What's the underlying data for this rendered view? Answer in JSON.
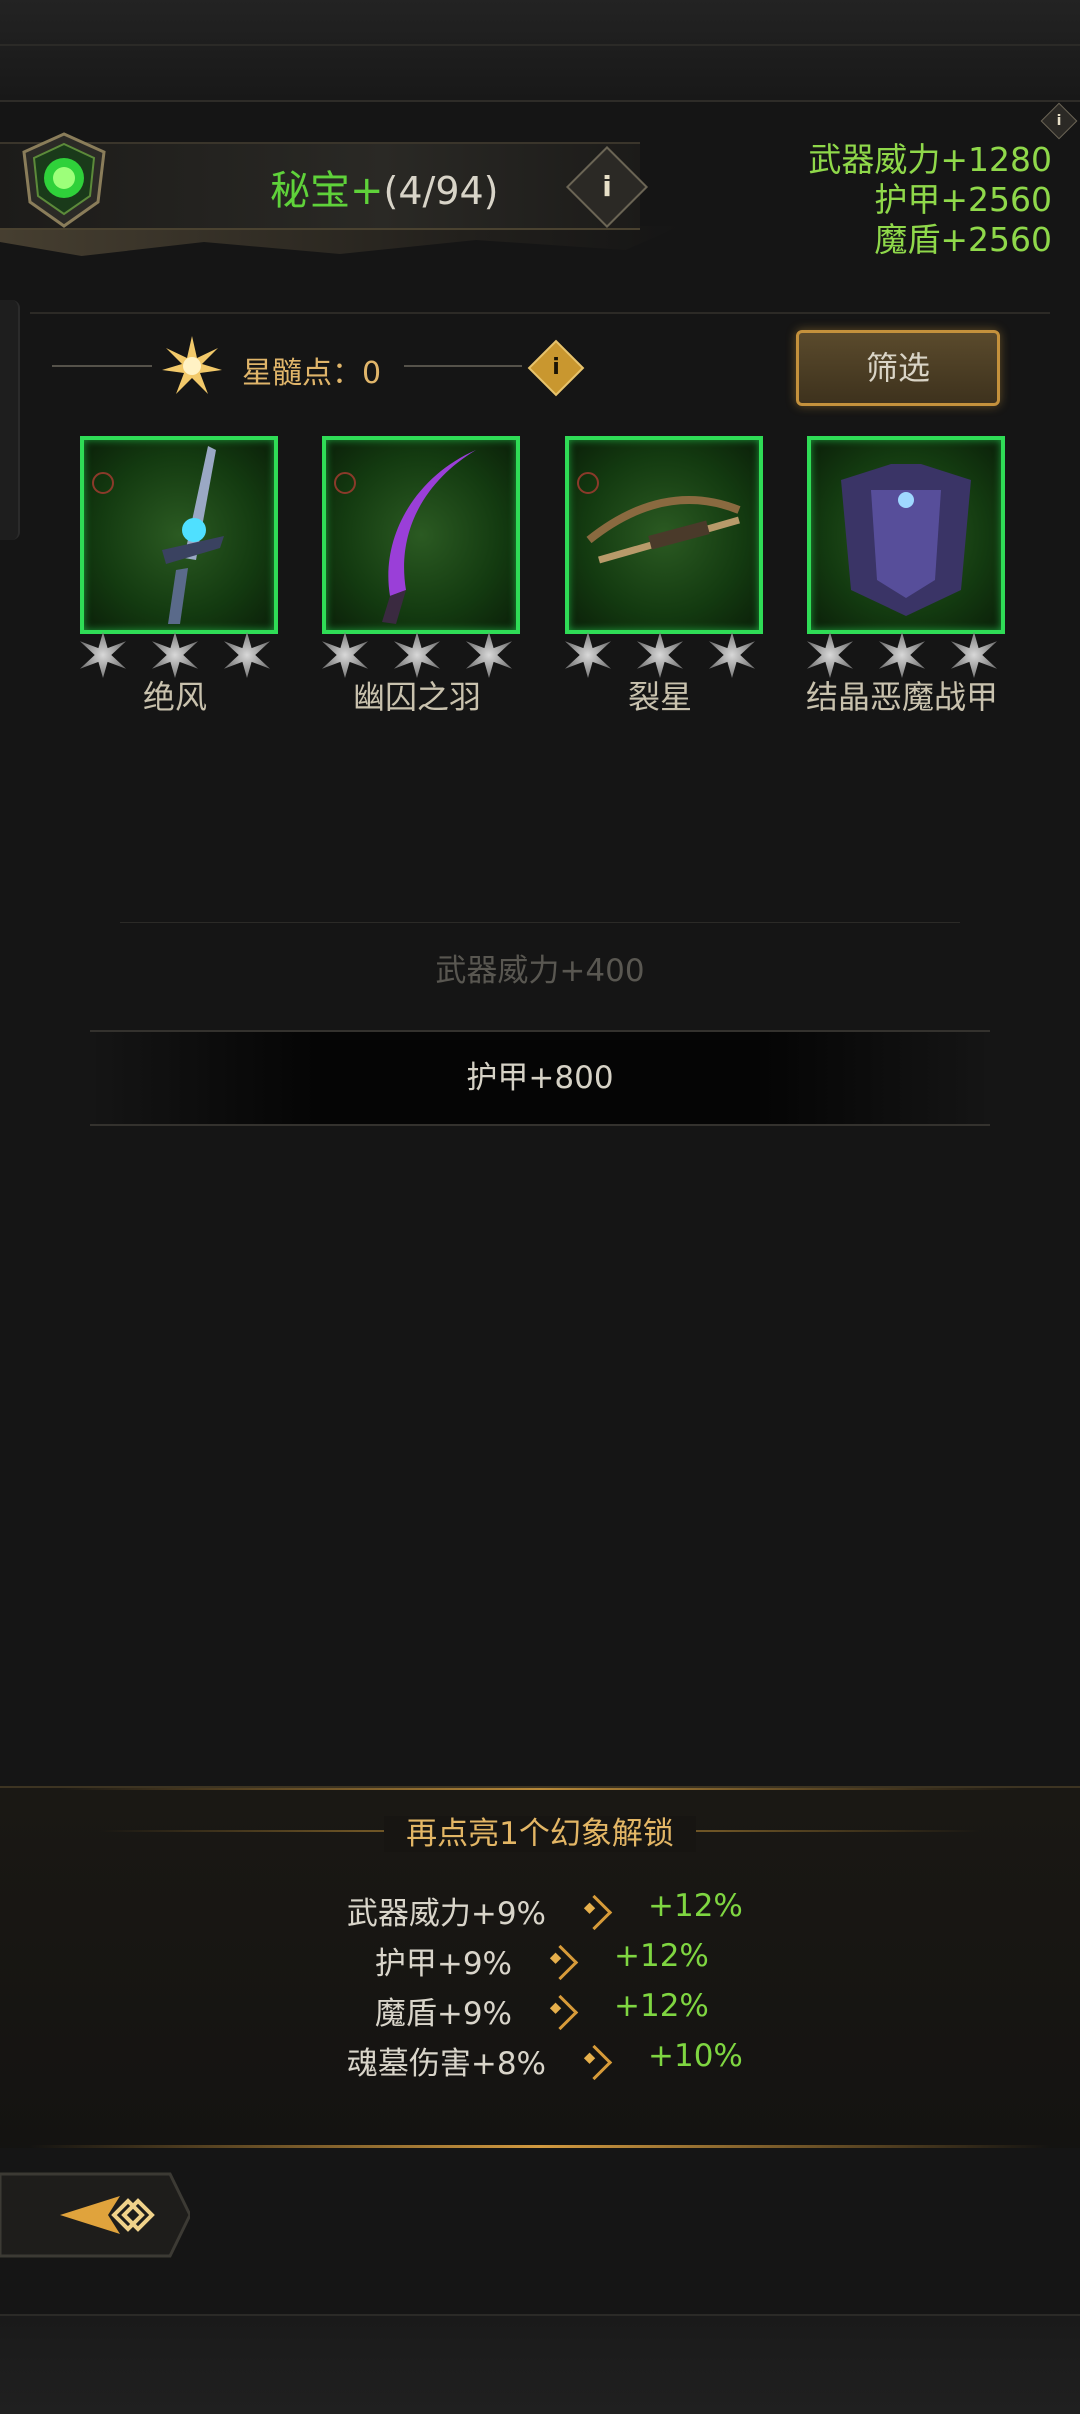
{
  "header": {
    "title": "秘宝+",
    "count": "(4/94)",
    "info_icon": "i"
  },
  "summary_stats": [
    "武器威力+1280",
    "护甲+2560",
    "魔盾+2560"
  ],
  "star_marrow": {
    "label": "星髓点：0",
    "info_icon": "i"
  },
  "filter_label": "筛选",
  "items": [
    {
      "name": "绝风",
      "icon": "sword-icon",
      "stars": 3
    },
    {
      "name": "幽囚之羽",
      "icon": "curved-blade-icon",
      "stars": 3
    },
    {
      "name": "裂星",
      "icon": "crossbow-icon",
      "stars": 3
    },
    {
      "name": "结晶恶魔战甲",
      "icon": "chest-armor-icon",
      "stars": 3
    }
  ],
  "bonuses": {
    "faded": "武器威力+400",
    "active": "护甲+800"
  },
  "unlock": {
    "title": "再点亮1个幻象解锁",
    "rows": [
      {
        "base": "武器威力+9%",
        "target": "+12%"
      },
      {
        "base": "护甲+9%",
        "target": "+12%"
      },
      {
        "base": "魔盾+9%",
        "target": "+12%"
      },
      {
        "base": "魂墓伤害+8%",
        "target": "+10%"
      }
    ]
  },
  "colors": {
    "green": "#5fd23a",
    "stat_green": "#8fd84a",
    "gold": "#e3b665",
    "card_border": "#2fdc56"
  }
}
